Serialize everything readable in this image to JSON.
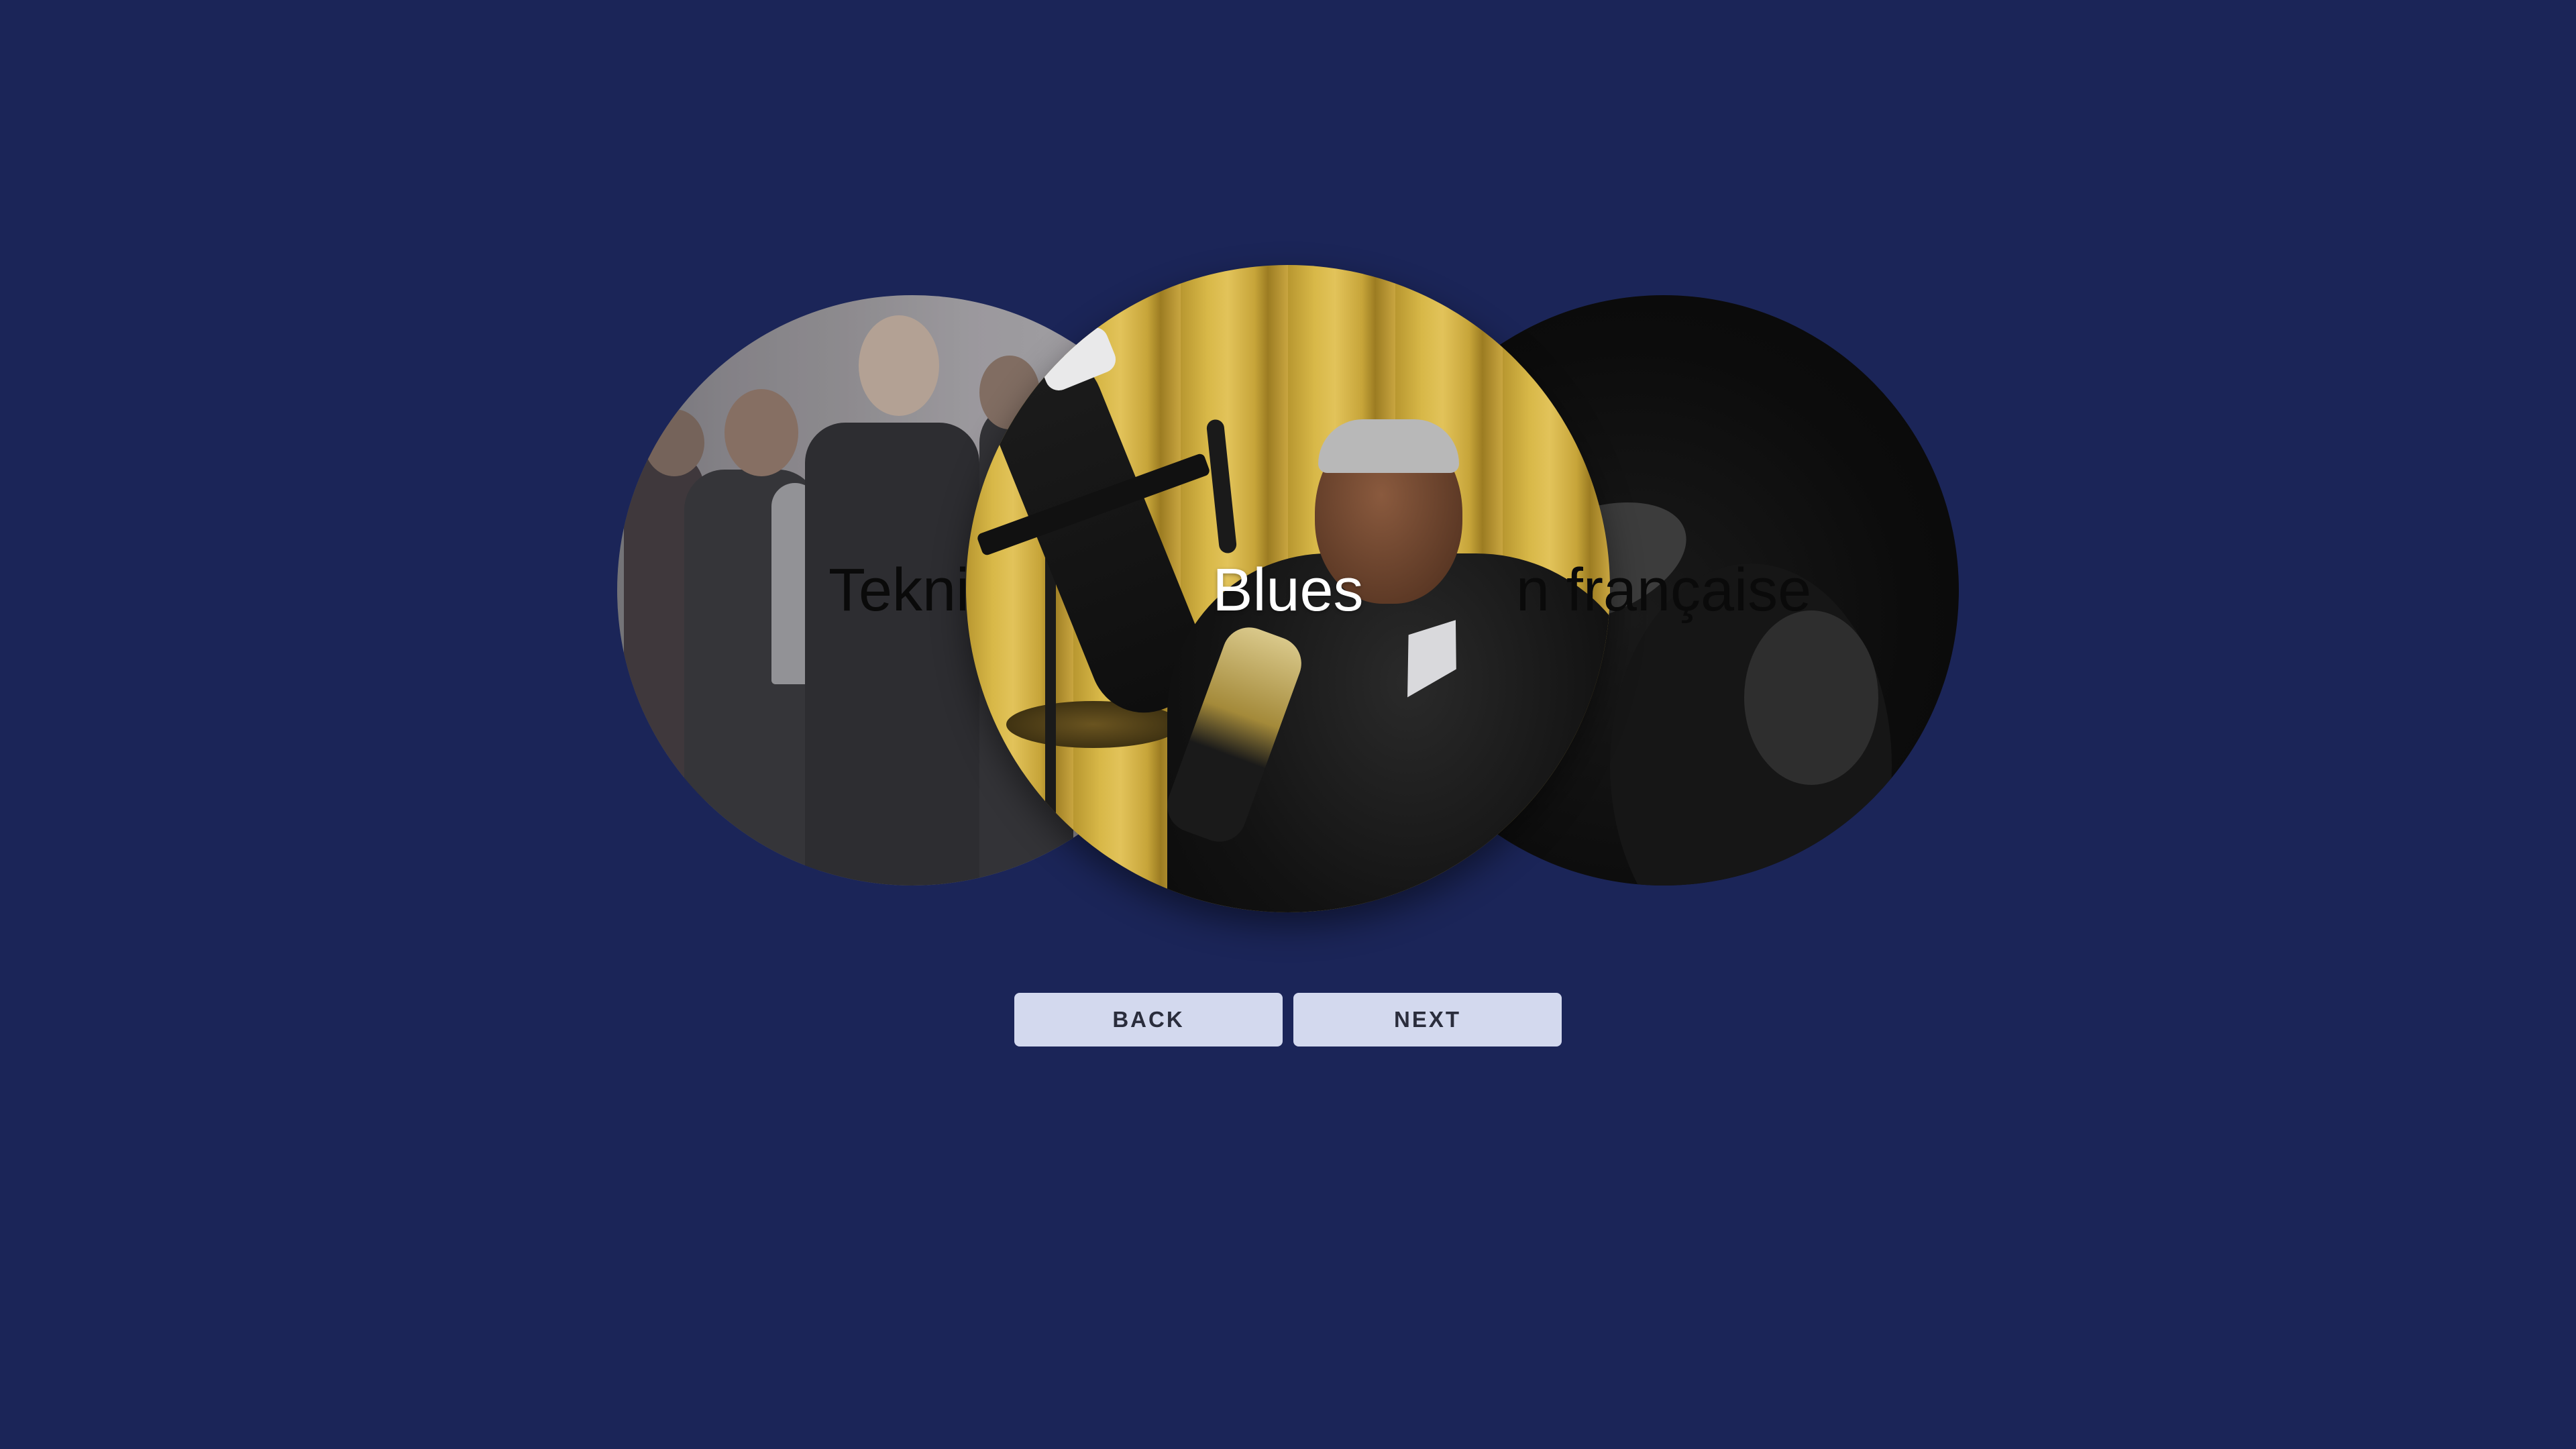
{
  "carousel": {
    "items": [
      {
        "label": "Tekni",
        "position": "left",
        "image": "band-group-photo"
      },
      {
        "label": "Blues",
        "position": "center",
        "image": "blues-guitarist-photo"
      },
      {
        "label": "n française",
        "position": "right",
        "image": "dark-performer-photo"
      }
    ]
  },
  "controls": {
    "back_label": "BACK",
    "next_label": "NEXT"
  },
  "colors": {
    "background": "#1b2558",
    "button_bg": "#d3d9ee",
    "button_text": "#2a2d3c"
  }
}
